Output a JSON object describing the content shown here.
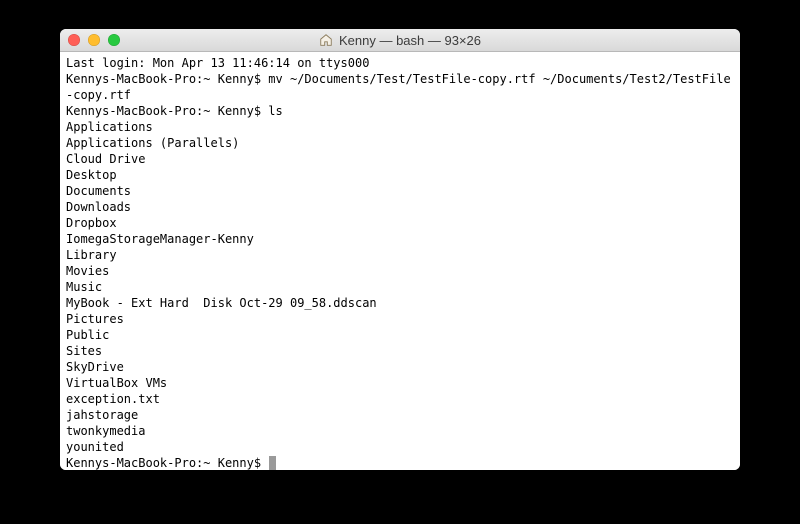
{
  "window": {
    "title": "Kenny — bash — 93×26"
  },
  "terminal": {
    "last_login": "Last login: Mon Apr 13 11:46:14 on ttys000",
    "prompt": "Kennys-MacBook-Pro:~ Kenny$ ",
    "cmd_mv": "mv ~/Documents/Test/TestFile-copy.rtf ~/Documents/Test2/TestFile-copy.rtf",
    "cmd_ls": "ls",
    "ls_output": [
      "Applications",
      "Applications (Parallels)",
      "Cloud Drive",
      "Desktop",
      "Documents",
      "Downloads",
      "Dropbox",
      "IomegaStorageManager-Kenny",
      "Library",
      "Movies",
      "Music",
      "MyBook - Ext Hard  Disk Oct-29 09_58.ddscan",
      "Pictures",
      "Public",
      "Sites",
      "SkyDrive",
      "VirtualBox VMs",
      "exception.txt",
      "jahstorage",
      "twonkymedia",
      "younited"
    ]
  }
}
